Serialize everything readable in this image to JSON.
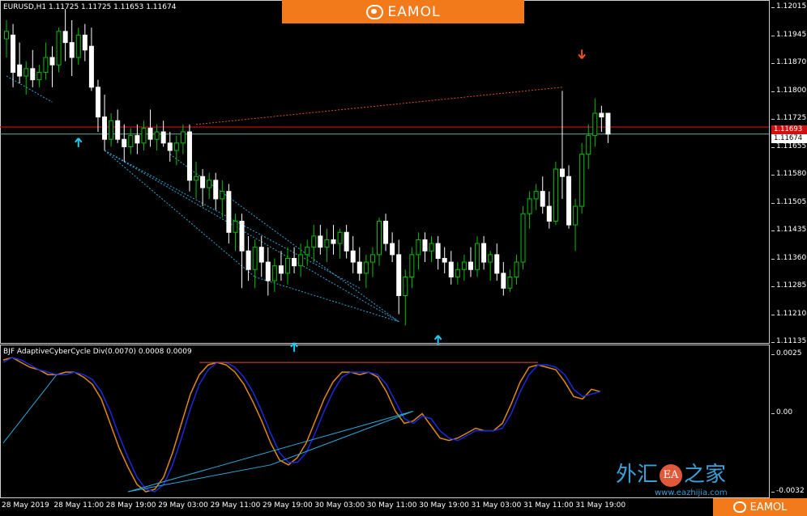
{
  "symbol_header": "EURUSD,H1  1.11725 1.11725 1.11653 1.11674",
  "indicator_header": "BJF AdaptiveCyberCycle Div(0.0070) 0.0008 0.0009",
  "brand_top": "EAMOL",
  "brand_bottom": "EAMOL",
  "watermark": {
    "left": "外汇",
    "seal": "EA",
    "right": "之家",
    "url": "www.eazhijia.com"
  },
  "price_axis": [
    "1.12015",
    "1.11945",
    "1.11870",
    "1.11800",
    "1.11725",
    "1.11655",
    "1.11580",
    "1.11505",
    "1.11435",
    "1.11360",
    "1.11285",
    "1.11210",
    "1.11135"
  ],
  "price_boxes": {
    "red_line": "1.11693",
    "current": "1.11674"
  },
  "indicator_axis": [
    "0.0025",
    "0.00",
    "-0.0032"
  ],
  "time_axis": [
    "28 May 2019",
    "28 May 11:00",
    "28 May 19:00",
    "29 May 03:00",
    "29 May 11:00",
    "29 May 19:00",
    "30 May 03:00",
    "30 May 11:00",
    "30 May 19:00",
    "31 May 03:00",
    "31 May 11:00",
    "31 May 19:00"
  ],
  "colors": {
    "bull": "#00c000",
    "bear": "#ffffff",
    "hline": "#d01010",
    "ghost": "#6fa8a8",
    "bluediv": "#2ea8d8",
    "reddiv": "#e0502a",
    "sig1": "#e08a10",
    "sig2": "#1a2adc",
    "arrowUp": "#22c8f0",
    "arrowDown": "#f0502a"
  },
  "chart_data": [
    {
      "type": "candlestick",
      "title": "EURUSD,H1",
      "ylim": [
        1.11115,
        1.1203
      ],
      "candles": [
        {
          "o": 1.1193,
          "h": 1.1198,
          "l": 1.1188,
          "c": 1.1195
        },
        {
          "o": 1.1194,
          "h": 1.1197,
          "l": 1.118,
          "c": 1.1184
        },
        {
          "o": 1.1186,
          "h": 1.1192,
          "l": 1.1181,
          "c": 1.1183
        },
        {
          "o": 1.1183,
          "h": 1.1187,
          "l": 1.1178,
          "c": 1.1185
        },
        {
          "o": 1.1185,
          "h": 1.119,
          "l": 1.118,
          "c": 1.1182
        },
        {
          "o": 1.1182,
          "h": 1.1186,
          "l": 1.118,
          "c": 1.1184
        },
        {
          "o": 1.1184,
          "h": 1.1192,
          "l": 1.1182,
          "c": 1.1188
        },
        {
          "o": 1.1188,
          "h": 1.1191,
          "l": 1.118,
          "c": 1.1186
        },
        {
          "o": 1.1186,
          "h": 1.1196,
          "l": 1.1184,
          "c": 1.1195
        },
        {
          "o": 1.1195,
          "h": 1.1201,
          "l": 1.1187,
          "c": 1.1192
        },
        {
          "o": 1.1192,
          "h": 1.1198,
          "l": 1.1183,
          "c": 1.1188
        },
        {
          "o": 1.1188,
          "h": 1.1196,
          "l": 1.1186,
          "c": 1.1194
        },
        {
          "o": 1.1194,
          "h": 1.1197,
          "l": 1.1187,
          "c": 1.119
        },
        {
          "o": 1.1191,
          "h": 1.1196,
          "l": 1.1179,
          "c": 1.118
        },
        {
          "o": 1.118,
          "h": 1.1182,
          "l": 1.1168,
          "c": 1.1172
        },
        {
          "o": 1.1172,
          "h": 1.1178,
          "l": 1.1163,
          "c": 1.1166
        },
        {
          "o": 1.1166,
          "h": 1.1173,
          "l": 1.1164,
          "c": 1.1171
        },
        {
          "o": 1.1171,
          "h": 1.1174,
          "l": 1.1165,
          "c": 1.1166
        },
        {
          "o": 1.1166,
          "h": 1.117,
          "l": 1.116,
          "c": 1.1164
        },
        {
          "o": 1.1164,
          "h": 1.1169,
          "l": 1.1162,
          "c": 1.1167
        },
        {
          "o": 1.1167,
          "h": 1.117,
          "l": 1.1162,
          "c": 1.1165
        },
        {
          "o": 1.1165,
          "h": 1.1171,
          "l": 1.1163,
          "c": 1.1169
        },
        {
          "o": 1.1169,
          "h": 1.1174,
          "l": 1.1164,
          "c": 1.1166
        },
        {
          "o": 1.1166,
          "h": 1.117,
          "l": 1.1163,
          "c": 1.1168
        },
        {
          "o": 1.1168,
          "h": 1.1171,
          "l": 1.1164,
          "c": 1.1165
        },
        {
          "o": 1.1165,
          "h": 1.1168,
          "l": 1.116,
          "c": 1.1163
        },
        {
          "o": 1.1163,
          "h": 1.1167,
          "l": 1.1159,
          "c": 1.1165
        },
        {
          "o": 1.1165,
          "h": 1.117,
          "l": 1.1162,
          "c": 1.1168
        },
        {
          "o": 1.1168,
          "h": 1.117,
          "l": 1.1152,
          "c": 1.1155
        },
        {
          "o": 1.1155,
          "h": 1.116,
          "l": 1.115,
          "c": 1.1156
        },
        {
          "o": 1.1156,
          "h": 1.1158,
          "l": 1.1148,
          "c": 1.1153
        },
        {
          "o": 1.1153,
          "h": 1.1157,
          "l": 1.115,
          "c": 1.1155
        },
        {
          "o": 1.1155,
          "h": 1.1157,
          "l": 1.1147,
          "c": 1.115
        },
        {
          "o": 1.115,
          "h": 1.1155,
          "l": 1.1145,
          "c": 1.1152
        },
        {
          "o": 1.1152,
          "h": 1.1154,
          "l": 1.1138,
          "c": 1.1141
        },
        {
          "o": 1.1141,
          "h": 1.1146,
          "l": 1.1136,
          "c": 1.1144
        },
        {
          "o": 1.1144,
          "h": 1.1146,
          "l": 1.1126,
          "c": 1.1136
        },
        {
          "o": 1.1136,
          "h": 1.114,
          "l": 1.1128,
          "c": 1.1131
        },
        {
          "o": 1.1131,
          "h": 1.1139,
          "l": 1.1126,
          "c": 1.1137
        },
        {
          "o": 1.1137,
          "h": 1.114,
          "l": 1.1129,
          "c": 1.1133
        },
        {
          "o": 1.1133,
          "h": 1.1137,
          "l": 1.1124,
          "c": 1.1128
        },
        {
          "o": 1.1128,
          "h": 1.1134,
          "l": 1.1125,
          "c": 1.1132
        },
        {
          "o": 1.1132,
          "h": 1.1136,
          "l": 1.1128,
          "c": 1.113
        },
        {
          "o": 1.113,
          "h": 1.1137,
          "l": 1.1127,
          "c": 1.1134
        },
        {
          "o": 1.1134,
          "h": 1.1137,
          "l": 1.113,
          "c": 1.1132
        },
        {
          "o": 1.1132,
          "h": 1.1138,
          "l": 1.1129,
          "c": 1.1135
        },
        {
          "o": 1.1135,
          "h": 1.1139,
          "l": 1.1132,
          "c": 1.1137
        },
        {
          "o": 1.1137,
          "h": 1.1143,
          "l": 1.1133,
          "c": 1.114
        },
        {
          "o": 1.114,
          "h": 1.1143,
          "l": 1.1135,
          "c": 1.1137
        },
        {
          "o": 1.1137,
          "h": 1.1142,
          "l": 1.1133,
          "c": 1.1139
        },
        {
          "o": 1.1139,
          "h": 1.1143,
          "l": 1.1135,
          "c": 1.1138
        },
        {
          "o": 1.1138,
          "h": 1.1142,
          "l": 1.1134,
          "c": 1.1141
        },
        {
          "o": 1.1141,
          "h": 1.1143,
          "l": 1.1134,
          "c": 1.1136
        },
        {
          "o": 1.1136,
          "h": 1.114,
          "l": 1.113,
          "c": 1.1133
        },
        {
          "o": 1.1133,
          "h": 1.1137,
          "l": 1.1128,
          "c": 1.113
        },
        {
          "o": 1.113,
          "h": 1.1135,
          "l": 1.1126,
          "c": 1.1133
        },
        {
          "o": 1.1133,
          "h": 1.1137,
          "l": 1.1129,
          "c": 1.1135
        },
        {
          "o": 1.1135,
          "h": 1.1145,
          "l": 1.1132,
          "c": 1.1144
        },
        {
          "o": 1.1144,
          "h": 1.1146,
          "l": 1.1136,
          "c": 1.1138
        },
        {
          "o": 1.1138,
          "h": 1.1141,
          "l": 1.1133,
          "c": 1.1135
        },
        {
          "o": 1.1135,
          "h": 1.1139,
          "l": 1.1119,
          "c": 1.1124
        },
        {
          "o": 1.1124,
          "h": 1.1131,
          "l": 1.1116,
          "c": 1.1129
        },
        {
          "o": 1.1129,
          "h": 1.1137,
          "l": 1.1126,
          "c": 1.1135
        },
        {
          "o": 1.1135,
          "h": 1.1141,
          "l": 1.1131,
          "c": 1.1139
        },
        {
          "o": 1.1139,
          "h": 1.1141,
          "l": 1.1133,
          "c": 1.1136
        },
        {
          "o": 1.1136,
          "h": 1.114,
          "l": 1.1133,
          "c": 1.1138
        },
        {
          "o": 1.1138,
          "h": 1.114,
          "l": 1.1131,
          "c": 1.1134
        },
        {
          "o": 1.1134,
          "h": 1.1137,
          "l": 1.113,
          "c": 1.1133
        },
        {
          "o": 1.1133,
          "h": 1.1136,
          "l": 1.1127,
          "c": 1.1129
        },
        {
          "o": 1.1129,
          "h": 1.1133,
          "l": 1.1127,
          "c": 1.1131
        },
        {
          "o": 1.1131,
          "h": 1.1135,
          "l": 1.1128,
          "c": 1.1133
        },
        {
          "o": 1.1133,
          "h": 1.1137,
          "l": 1.1129,
          "c": 1.1131
        },
        {
          "o": 1.1131,
          "h": 1.114,
          "l": 1.1129,
          "c": 1.1138
        },
        {
          "o": 1.1138,
          "h": 1.114,
          "l": 1.1131,
          "c": 1.1133
        },
        {
          "o": 1.1133,
          "h": 1.1136,
          "l": 1.1128,
          "c": 1.1135
        },
        {
          "o": 1.1135,
          "h": 1.1138,
          "l": 1.1128,
          "c": 1.113
        },
        {
          "o": 1.113,
          "h": 1.1133,
          "l": 1.1124,
          "c": 1.1126
        },
        {
          "o": 1.1126,
          "h": 1.1131,
          "l": 1.1125,
          "c": 1.1129
        },
        {
          "o": 1.1129,
          "h": 1.1135,
          "l": 1.1127,
          "c": 1.1133
        },
        {
          "o": 1.1133,
          "h": 1.1148,
          "l": 1.1131,
          "c": 1.1146
        },
        {
          "o": 1.1146,
          "h": 1.1152,
          "l": 1.1142,
          "c": 1.115
        },
        {
          "o": 1.115,
          "h": 1.1154,
          "l": 1.1147,
          "c": 1.1152
        },
        {
          "o": 1.1152,
          "h": 1.1156,
          "l": 1.1146,
          "c": 1.1148
        },
        {
          "o": 1.1148,
          "h": 1.1152,
          "l": 1.1142,
          "c": 1.1144
        },
        {
          "o": 1.1144,
          "h": 1.116,
          "l": 1.1143,
          "c": 1.1158
        },
        {
          "o": 1.1158,
          "h": 1.1179,
          "l": 1.115,
          "c": 1.1156
        },
        {
          "o": 1.1156,
          "h": 1.1159,
          "l": 1.1142,
          "c": 1.1143
        },
        {
          "o": 1.1143,
          "h": 1.115,
          "l": 1.1136,
          "c": 1.1148
        },
        {
          "o": 1.1148,
          "h": 1.1165,
          "l": 1.1146,
          "c": 1.1162
        },
        {
          "o": 1.1162,
          "h": 1.117,
          "l": 1.1158,
          "c": 1.1167
        },
        {
          "o": 1.1167,
          "h": 1.1177,
          "l": 1.1164,
          "c": 1.1173
        },
        {
          "o": 1.1173,
          "h": 1.1175,
          "l": 1.1168,
          "c": 1.1172
        },
        {
          "o": 1.1173,
          "h": 1.1173,
          "l": 1.1165,
          "c": 1.11674
        }
      ],
      "horizontal_lines": [
        1.11693,
        1.11674
      ]
    },
    {
      "type": "line",
      "title": "BJF AdaptiveCyberCycle Div(0.0070) 0.0008 0.0009",
      "ylim": [
        -0.0032,
        0.0025
      ],
      "series": [
        {
          "values": [
            0.0022,
            0.0023,
            0.0021,
            0.0019,
            0.0018,
            0.0016,
            0.0016,
            0.0017,
            0.0017,
            0.0015,
            0.0012,
            0.0006,
            -0.0004,
            -0.0014,
            -0.0022,
            -0.0029,
            -0.0032,
            -0.0031,
            -0.0026,
            -0.0016,
            -0.0004,
            0.0008,
            0.0016,
            0.002,
            0.0021,
            0.002,
            0.0017,
            0.0012,
            0.0005,
            -0.0003,
            -0.0012,
            -0.0019,
            -0.0021,
            -0.0018,
            -0.0012,
            -0.0003,
            0.0006,
            0.0013,
            0.0017,
            0.0017,
            0.0016,
            0.0017,
            0.0015,
            0.0009,
            0.0001,
            -0.0004,
            -0.0003,
            0.0,
            -0.0005,
            -0.001,
            -0.0011,
            -0.001,
            -0.0008,
            -0.0006,
            -0.0007,
            -0.0007,
            -0.0004,
            0.0004,
            0.0013,
            0.0019,
            0.002,
            0.0019,
            0.0018,
            0.0013,
            0.0007,
            0.0006,
            0.001,
            0.0009
          ]
        },
        {
          "values": [
            0.0021,
            0.0023,
            0.0022,
            0.002,
            0.0018,
            0.0017,
            0.0016,
            0.0016,
            0.0017,
            0.0016,
            0.0014,
            0.0009,
            0.0001,
            -0.0009,
            -0.0018,
            -0.0026,
            -0.0031,
            -0.0032,
            -0.0029,
            -0.0021,
            -0.001,
            0.0002,
            0.0012,
            0.0018,
            0.0021,
            0.0021,
            0.0019,
            0.0015,
            0.0009,
            0.0001,
            -0.0008,
            -0.0016,
            -0.002,
            -0.002,
            -0.0016,
            -0.0008,
            0.0001,
            0.0009,
            0.0015,
            0.0017,
            0.0017,
            0.0017,
            0.0016,
            0.0012,
            0.0005,
            -0.0002,
            -0.0004,
            -0.0001,
            -0.0002,
            -0.0007,
            -0.001,
            -0.0011,
            -0.0009,
            -0.0007,
            -0.0007,
            -0.0007,
            -0.0006,
            0.0,
            0.0009,
            0.0016,
            0.002,
            0.002,
            0.0019,
            0.0016,
            0.001,
            0.0007,
            0.0008,
            0.0009
          ]
        }
      ]
    }
  ]
}
